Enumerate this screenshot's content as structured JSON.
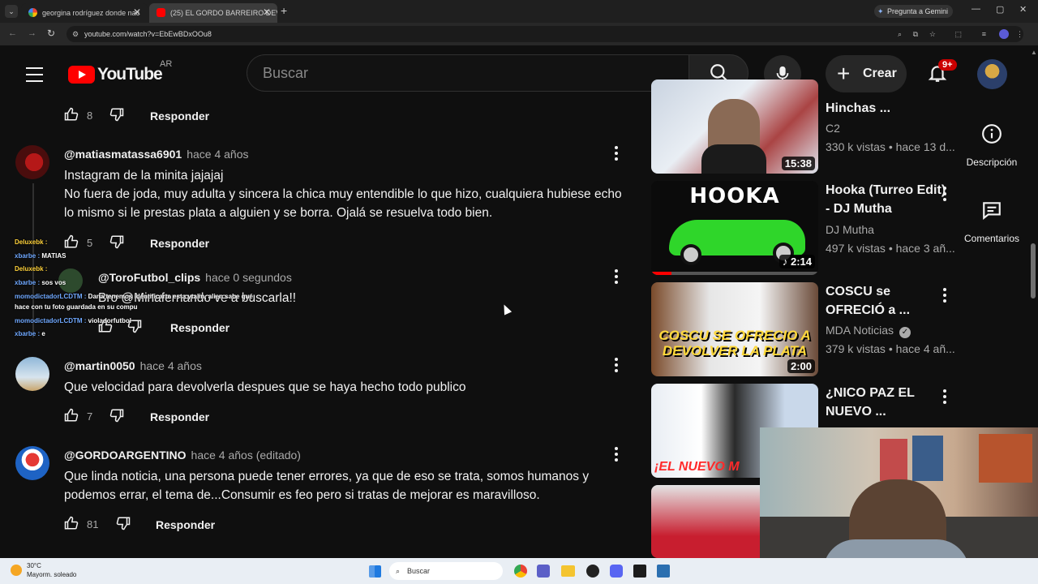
{
  "browser": {
    "tabs": [
      {
        "title": "georgina rodríguez donde nac",
        "active": false
      },
      {
        "title": "(25) EL GORDO BARREIRO DEVO",
        "active": true
      }
    ],
    "new_tab": "+",
    "gemini": "Pregunta a Gemini",
    "url": "youtube.com/watch?v=EbEwBDxOOu8"
  },
  "youtube": {
    "logo_text": "YouTube",
    "country": "AR",
    "search_placeholder": "Buscar",
    "create_label": "Crear",
    "notif_badge": "9+"
  },
  "comments": [
    {
      "likes": "8",
      "reply": "Responder"
    },
    {
      "author": "@matiasmatassa6901",
      "time": "hace 4 años",
      "text": "Instagram de la minita jajajaj\nNo fuera de joda, muy adulta y sincera la chica muy entendible lo que hizo, cualquiera hubiese echo lo mismo si le prestas plata a alguien y se borra. Ojalá se resuelva todo bien.",
      "likes": "5",
      "reply": "Responder"
    },
    {
      "author": "@ToroFutbol_clips",
      "time": "hace 0 segundos",
      "text": "Bro @Minafernando ve a buscarla!!",
      "reply": "Responder"
    },
    {
      "author": "@martin0050",
      "time": "hace 4 años",
      "text": "Que velocidad para devolverla despues que se haya hecho todo publico",
      "likes": "7",
      "reply": "Responder"
    },
    {
      "author": "@GORDOARGENTINO",
      "time": "hace 4 años (editado)",
      "text": "Que linda noticia, una persona puede tener errores, ya que de eso se trata, somos humanos y podemos errar, el tema de...Consumir es feo pero si tratas de mejorar es maravilloso.",
      "likes": "81",
      "reply": "Responder"
    }
  ],
  "chat_overlay": [
    {
      "user": "Deluxebk :",
      "msg": ""
    },
    {
      "user": "xbarbe :",
      "msg": "MATIAS"
    },
    {
      "user": "Deluxebk :",
      "msg": ""
    },
    {
      "user": "xbarbe :",
      "msg": "sos vos"
    },
    {
      "user": "momodictadorLCDTM :",
      "msg": "Dana tenemos identificarte esta ytalin, alien sabe qué"
    },
    {
      "user": "",
      "msg": "hace con tu foto guardada en su compu"
    },
    {
      "user": "momodictadorLCDTM :",
      "msg": "violadorfutbol"
    },
    {
      "user": "xbarbe :",
      "msg": "e"
    }
  ],
  "recommendations": [
    {
      "title": "Hinchas ...",
      "channel": "C2",
      "meta": "330 k vistas • hace 13 d...",
      "duration": "15:38",
      "verified": false
    },
    {
      "title": "Hooka (Turreo Edit) - DJ Mutha",
      "channel": "DJ Mutha",
      "meta": "497 k vistas • hace 3 añ...",
      "duration": "2:14",
      "thumb_text": "HOOKA",
      "verified": false
    },
    {
      "title": "COSCU se OFRECIÓ a ...",
      "channel": "MDA Noticias",
      "meta": "379 k vistas • hace 4 añ...",
      "duration": "2:00",
      "thumb_text": "COSCU SE OFRECIO A DEVOLVER LA PLATA",
      "verified": true
    },
    {
      "title": "¿NICO PAZ EL NUEVO ...",
      "channel": "",
      "meta": "",
      "duration": "",
      "thumb_text": "¡EL NUEVO M",
      "verified": false
    }
  ],
  "side_panel": {
    "description": "Descripción",
    "comments": "Comentarios"
  },
  "taskbar": {
    "temp": "30°C",
    "weather": "Mayorm. soleado",
    "search": "Buscar"
  }
}
